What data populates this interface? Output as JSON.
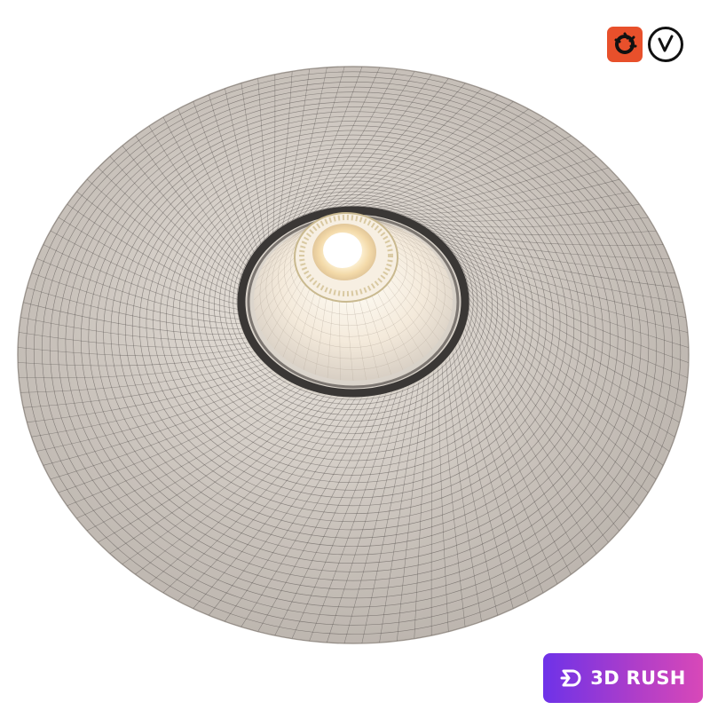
{
  "scene": {
    "subject": "recessed-downlight-with-flared-shade",
    "render_style": "wireframe-over-shaded",
    "colors": {
      "background": "#ffffff",
      "shade_surface": "#c7c0b9",
      "shade_highlight": "#ddd7d0",
      "wire": "#4a4643",
      "trim_ring": "#3a3735",
      "light_core": "#fff6dc",
      "light_glow": "#f3cf8a"
    }
  },
  "render_badges": [
    {
      "name": "corona-renderer",
      "icon": "corona-icon",
      "color": "#e8502b"
    },
    {
      "name": "vray",
      "icon": "vray-icon",
      "color": "#111111"
    }
  ],
  "brand": {
    "text": "3D RUSH",
    "icon": "3drush-logo-icon",
    "gradient_start": "#6e32e8",
    "gradient_end": "#d848b8"
  }
}
